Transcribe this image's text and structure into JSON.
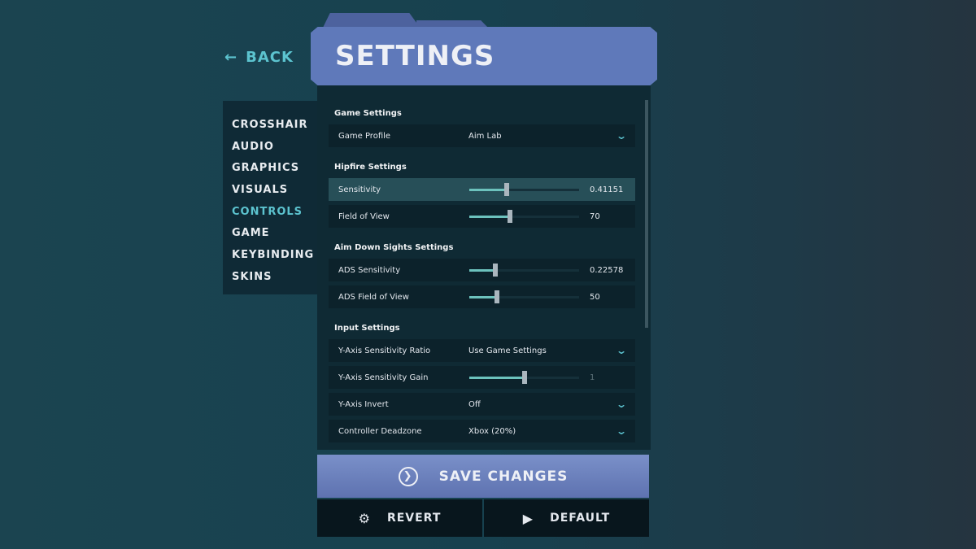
{
  "back_label": "BACK",
  "title": "SETTINGS",
  "nav": [
    {
      "label": "CROSSHAIR"
    },
    {
      "label": "AUDIO"
    },
    {
      "label": "GRAPHICS"
    },
    {
      "label": "VISUALS"
    },
    {
      "label": "CONTROLS",
      "active": true
    },
    {
      "label": "GAME"
    },
    {
      "label": "KEYBINDING"
    },
    {
      "label": "SKINS"
    }
  ],
  "sections": {
    "game": "Game Settings",
    "hipfire": "Hipfire Settings",
    "ads": "Aim Down Sights Settings",
    "input": "Input Settings"
  },
  "rows": {
    "game_profile": {
      "label": "Game Profile",
      "value": "Aim Lab"
    },
    "sensitivity": {
      "label": "Sensitivity",
      "value": "0.41151",
      "fraction": 0.34
    },
    "fov": {
      "label": "Field of View",
      "value": "70",
      "fraction": 0.37
    },
    "ads_sens": {
      "label": "ADS Sensitivity",
      "value": "0.22578",
      "fraction": 0.24
    },
    "ads_fov": {
      "label": "ADS Field of View",
      "value": "50",
      "fraction": 0.25
    },
    "y_ratio": {
      "label": "Y-Axis Sensitivity Ratio",
      "value": "Use Game Settings"
    },
    "y_gain": {
      "label": "Y-Axis Sensitivity Gain",
      "value": "1",
      "fraction": 0.5
    },
    "y_invert": {
      "label": "Y-Axis Invert",
      "value": "Off"
    },
    "deadzone": {
      "label": "Controller Deadzone",
      "value": "Xbox (20%)"
    }
  },
  "buttons": {
    "save": "SAVE CHANGES",
    "revert": "REVERT",
    "default": "DEFAULT"
  },
  "colors": {
    "accent": "#5cc3cf",
    "header": "#5f79ba",
    "slider_fill": "#6cc2bd"
  }
}
